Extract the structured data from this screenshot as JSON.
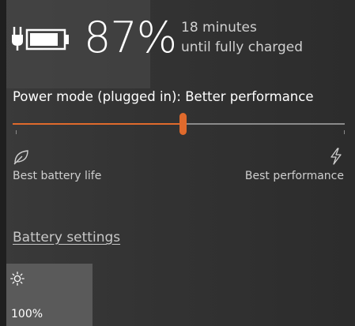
{
  "battery": {
    "percent_label": "87%",
    "percent": 87,
    "charging": true,
    "time_remaining": "18 minutes",
    "time_caption": "until fully charged"
  },
  "power_mode": {
    "label": "Power mode (plugged in): Better performance",
    "slider_position": 0.5,
    "min_label": "Best battery life",
    "max_label": "Best performance",
    "min_icon": "leaf-icon",
    "max_icon": "lightning-bolt-icon"
  },
  "links": {
    "battery_settings": "Battery settings"
  },
  "quick_action": {
    "icon": "brightness-sun-icon",
    "value": "100%"
  },
  "colors": {
    "accent": "#e06a2c",
    "track": "#8a8a8a",
    "background": "#2b2b2b",
    "tile": "#5a5a5a"
  }
}
